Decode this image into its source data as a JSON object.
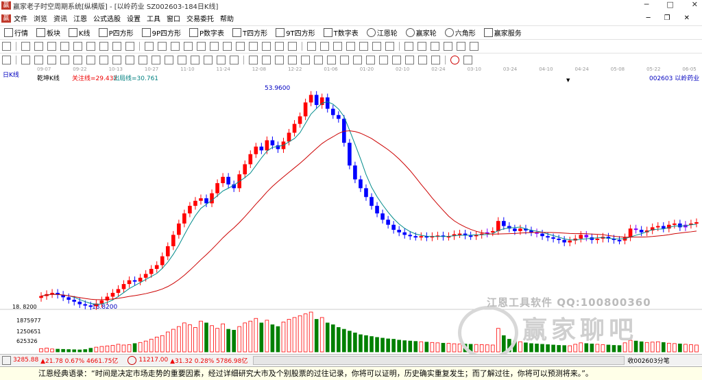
{
  "window": {
    "title": "赢家老子时空周期系统[纵横版] - [以岭药业  SZ002603-184日K线]",
    "controls": [
      "─",
      "□",
      "✕"
    ]
  },
  "menu": {
    "items": [
      "文件",
      "浏览",
      "资讯",
      "江恩",
      "公式选股",
      "设置",
      "工具",
      "窗口",
      "交易委托",
      "帮助"
    ],
    "right": [
      "─",
      "❐",
      "✕"
    ]
  },
  "toolbar1": {
    "items": [
      "行情",
      "板块",
      "K线",
      "P四方形",
      "9P四方形",
      "P数字表",
      "T四方形",
      "9T四方形",
      "T数字表",
      "江恩轮",
      "赢家轮",
      "六角形",
      "赢家服务"
    ]
  },
  "chart": {
    "period_label": "日K线",
    "dates": [
      "09-07",
      "09-22",
      "10-13",
      "10-27",
      "11-10",
      "11-24",
      "12-08",
      "12-22",
      "01-06",
      "01-20",
      "02-10",
      "02-24",
      "03-10",
      "03-24",
      "04-10",
      "04-24",
      "05-08",
      "05-22",
      "06-05"
    ],
    "indicator_name": "乾坤K线",
    "focus_line": "关注线=29.437",
    "exit_line": "出局线=30.761",
    "stock": "002603  以岭药业",
    "high_label": "53.9600",
    "low_label": "18.8200",
    "price_axis_label": "18. 8200",
    "volume_ticks": [
      "1875977",
      "1250651",
      "625326"
    ],
    "colors": {
      "up": "#ff0000",
      "down": "#0000ff",
      "purple": "#8000ff",
      "ma_fast": "#008b8b",
      "ma_slow": "#cc0000",
      "vol_up": "#ff0000",
      "vol_down": "#008000"
    }
  },
  "chart_data": {
    "type": "candlestick",
    "note_x": "days index",
    "close": [
      20.5,
      20.8,
      21.0,
      20.7,
      20.3,
      19.9,
      19.6,
      19.2,
      19.0,
      18.9,
      19.3,
      19.8,
      20.4,
      21.0,
      21.6,
      22.4,
      23.0,
      22.8,
      23.4,
      24.0,
      24.8,
      25.4,
      26.8,
      28.4,
      30.2,
      32.0,
      33.6,
      34.8,
      35.6,
      36.0,
      35.2,
      36.8,
      38.4,
      39.4,
      38.2,
      37.6,
      39.8,
      41.4,
      43.0,
      44.2,
      43.6,
      45.2,
      44.4,
      43.8,
      45.0,
      46.4,
      47.8,
      49.0,
      51.2,
      52.4,
      50.8,
      52.0,
      50.2,
      49.2,
      48.6,
      44.8,
      41.2,
      39.0,
      37.6,
      36.2,
      34.8,
      33.6,
      32.6,
      31.8,
      31.0,
      30.6,
      30.2,
      30.0,
      29.9,
      30.0,
      29.8,
      30.0,
      30.1,
      29.9,
      30.0,
      30.3,
      30.4,
      30.1,
      30.0,
      30.2,
      30.4,
      30.6,
      30.8,
      32.4,
      31.6,
      31.2,
      30.8,
      31.2,
      30.9,
      30.6,
      30.4,
      30.0,
      29.8,
      29.6,
      29.4,
      29.0,
      29.3,
      29.6,
      30.2,
      29.8,
      29.4,
      29.6,
      29.9,
      29.6,
      29.4,
      29.3,
      29.8,
      31.2,
      31.0,
      30.6,
      30.9,
      31.4,
      31.6,
      31.2,
      31.8,
      32.0,
      31.4,
      31.8,
      32.0,
      32.2
    ],
    "volume": [
      180,
      210,
      160,
      150,
      140,
      130,
      120,
      110,
      130,
      200,
      260,
      300,
      330,
      360,
      420,
      380,
      400,
      460,
      520,
      600,
      700,
      820,
      900,
      1100,
      1250,
      1400,
      1600,
      1500,
      1350,
      1700,
      1600,
      1450,
      1300,
      1550,
      1250,
      1200,
      1400,
      1600,
      1700,
      1850,
      1600,
      1750,
      1500,
      1400,
      1650,
      1800,
      1900,
      2000,
      2100,
      2200,
      1800,
      1900,
      1600,
      1500,
      1350,
      1250,
      1150,
      1050,
      950,
      900,
      850,
      800,
      760,
      720,
      700,
      650,
      620,
      600,
      580,
      560,
      540,
      520,
      500,
      480,
      470,
      450,
      440,
      430,
      420,
      410,
      400,
      390,
      380,
      1300,
      900,
      700,
      600,
      560,
      500,
      460,
      440,
      420,
      400,
      380,
      360,
      350,
      340,
      420,
      500,
      460,
      440,
      420,
      400,
      380,
      360,
      350,
      500,
      640,
      600,
      560,
      520,
      540,
      560,
      520,
      480,
      460,
      440,
      420,
      400,
      380
    ]
  },
  "watermark": {
    "line1": "江恩工具软件  QQ:100800360",
    "line2": "赢家聊吧",
    "line3": "jiaoba.yuc361.com"
  },
  "status": {
    "index1": "3285.88",
    "change1": "▲21.78 0.67% 4661.75亿",
    "index2": "11217.00",
    "change2": "▲31.32 0.28% 5786.98亿",
    "right": "收002603分笔"
  },
  "quote": "江恩经典语录：“时间是决定市场走势的重要因素，经过详细研究大市及个别股票的过往记录，你将可以证明，历史确实重复发生；而了解过往，你将可以预测将来。”。"
}
